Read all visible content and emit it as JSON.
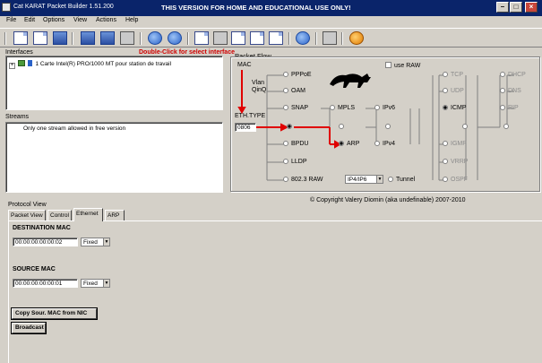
{
  "window": {
    "title": "Cat KARAT Packet Builder 1.51.200",
    "notice": "THIS VERSION FOR HOME AND EDUCATIONAL USE ONLY!"
  },
  "menu": [
    "File",
    "Edit",
    "Options",
    "View",
    "Actions",
    "Help"
  ],
  "toolbar_icons": [
    "new-icon",
    "open-icon",
    "save-icon",
    "list-icon",
    "save-blue-icon",
    "properties-icon",
    "play-icon",
    "stop-icon",
    "select-icon",
    "erase-icon",
    "copy-icon",
    "clipboard-icon",
    "refresh-icon",
    "camera-icon",
    "cat-icon"
  ],
  "interfaces": {
    "label": "Interfaces",
    "hint": "Double-Click for select interface",
    "item": "1 Carte Intel(R) PRO/1000 MT pour station de travail"
  },
  "streams": {
    "label": "Streams",
    "item": "Only one stream allowed in free version"
  },
  "packet_flow": {
    "label": "Packet Flow",
    "use_raw": "use RAW",
    "mac": "MAC",
    "vlan": "Vlan",
    "qinq": "QinQ",
    "eth_type": "ETH.TYPE",
    "eth_value": "0806",
    "col1": [
      "PPPoE",
      "OAM",
      "SNAP",
      "",
      "BPDU",
      "LLDP",
      "802.3 RAW"
    ],
    "col2": [
      "MPLS",
      "",
      "ARP"
    ],
    "ip_select": "IP4/IP6",
    "tunnel": "Tunnel",
    "col3": [
      "IPv6",
      "",
      "IPv4"
    ],
    "col4": [
      "TCP",
      "UDP",
      "ICMP",
      "",
      "IGMP",
      "VRRP",
      "OSPF"
    ],
    "col5": [
      "DHCP",
      "DNS",
      "RIP",
      ""
    ],
    "copyright": "© Copyright Valery Diomin (aka undefinable) 2007-2010"
  },
  "protocol_view": {
    "label": "Protocol View",
    "tabs": [
      "Packet View",
      "Control",
      "Ethernet",
      "ARP"
    ],
    "active_tab": "Ethernet",
    "dest_label": "DESTINATION MAC",
    "dest_value": "00:00:00:00:00:02",
    "dest_mode": "Fixed",
    "src_label": "SOURCE MAC",
    "src_value": "00:00:00:00:00:01",
    "src_mode": "Fixed",
    "copy_button": "Copy Sour. MAC from NIC",
    "broadcast_button": "Broadcast"
  }
}
